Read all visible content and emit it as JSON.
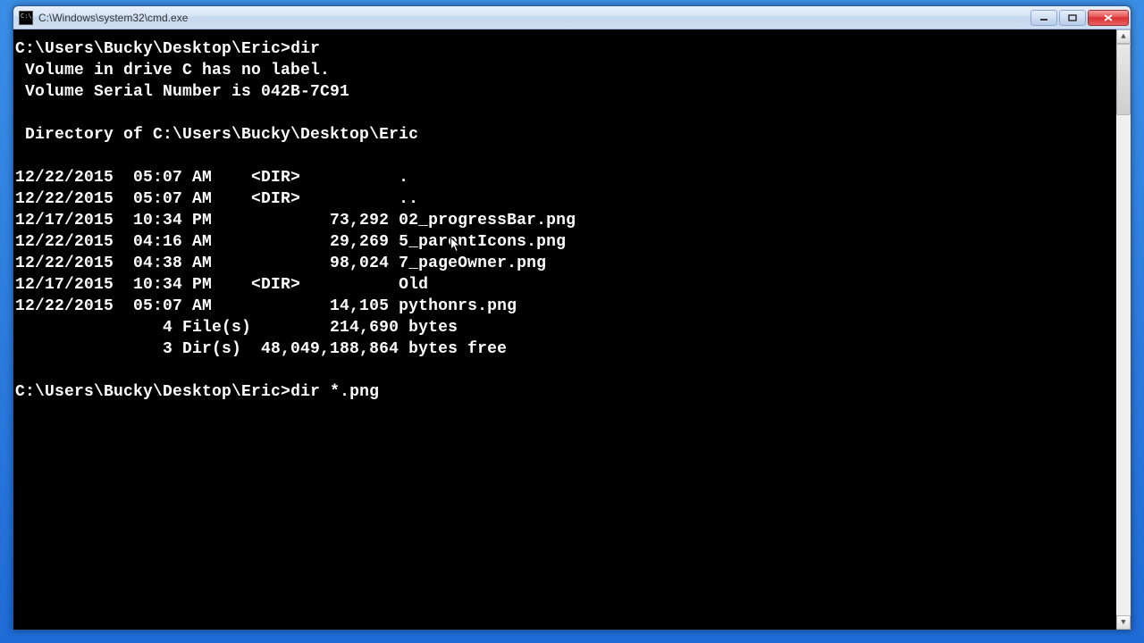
{
  "window": {
    "title": "C:\\Windows\\system32\\cmd.exe"
  },
  "terminal": {
    "prompt1": "C:\\Users\\Bucky\\Desktop\\Eric>",
    "command1": "dir",
    "vol_line1": " Volume in drive C has no label.",
    "vol_line2": " Volume Serial Number is 042B-7C91",
    "dir_of": " Directory of C:\\Users\\Bucky\\Desktop\\Eric",
    "entries": [
      "12/22/2015  05:07 AM    <DIR>          .",
      "12/22/2015  05:07 AM    <DIR>          ..",
      "12/17/2015  10:34 PM            73,292 02_progressBar.png",
      "12/22/2015  04:16 AM            29,269 5_parentIcons.png",
      "12/22/2015  04:38 AM            98,024 7_pageOwner.png",
      "12/17/2015  10:34 PM    <DIR>          Old",
      "12/22/2015  05:07 AM            14,105 pythonrs.png"
    ],
    "summary1": "               4 File(s)        214,690 bytes",
    "summary2": "               3 Dir(s)  48,049,188,864 bytes free",
    "prompt2": "C:\\Users\\Bucky\\Desktop\\Eric>",
    "command2": "dir *.png"
  }
}
